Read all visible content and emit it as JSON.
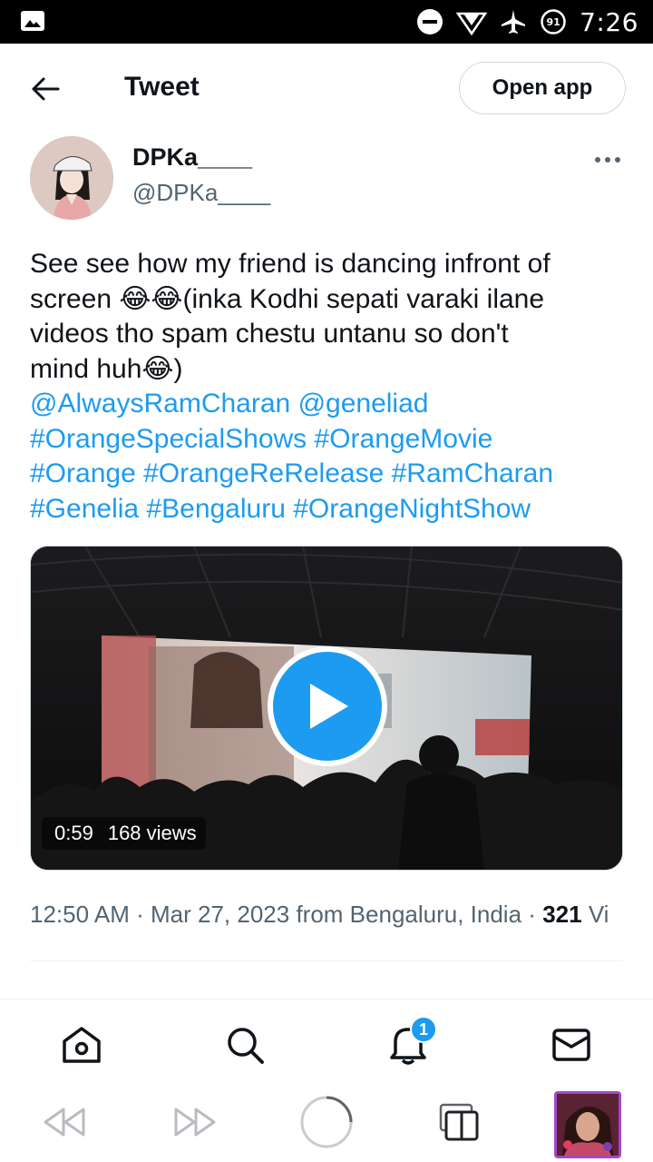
{
  "status_bar": {
    "time": "7:26",
    "battery_level": "91",
    "icons": [
      "image-icon",
      "do-not-disturb-icon",
      "signal-icon",
      "airplane-icon",
      "battery-icon"
    ]
  },
  "header": {
    "title": "Tweet",
    "open_app_label": "Open app"
  },
  "author": {
    "name": "DPKa____",
    "handle": "@DPKa____"
  },
  "tweet": {
    "lines": [
      "See see how my friend is dancing infront of",
      "screen 😂😂(inka Kodhi sepati varaki ilane",
      "videos tho spam chestu untanu so don't",
      "mind huh😂)"
    ],
    "mentions": [
      "@AlwaysRamCharan",
      "@geneliad"
    ],
    "hashtags": [
      "#OrangeSpecialShows",
      "#OrangeMovie",
      "#Orange",
      "#OrangeReRelease",
      "#RamCharan",
      "#Genelia",
      "#Bengaluru",
      "#OrangeNightShow"
    ]
  },
  "video": {
    "duration": "0:59",
    "views": "168 views"
  },
  "meta": {
    "time": "12:50 AM",
    "separator": "·",
    "date": "Mar 27, 2023",
    "location": "from Bengaluru, India",
    "views_count": "321",
    "views_label": "Vi"
  },
  "tabbar": {
    "items": [
      "home-icon",
      "search-icon",
      "notifications-icon",
      "messages-icon"
    ],
    "notification_badge": "1"
  },
  "colors": {
    "accent": "#1d9bf0",
    "text": "#0f1419",
    "muted": "#536471"
  }
}
